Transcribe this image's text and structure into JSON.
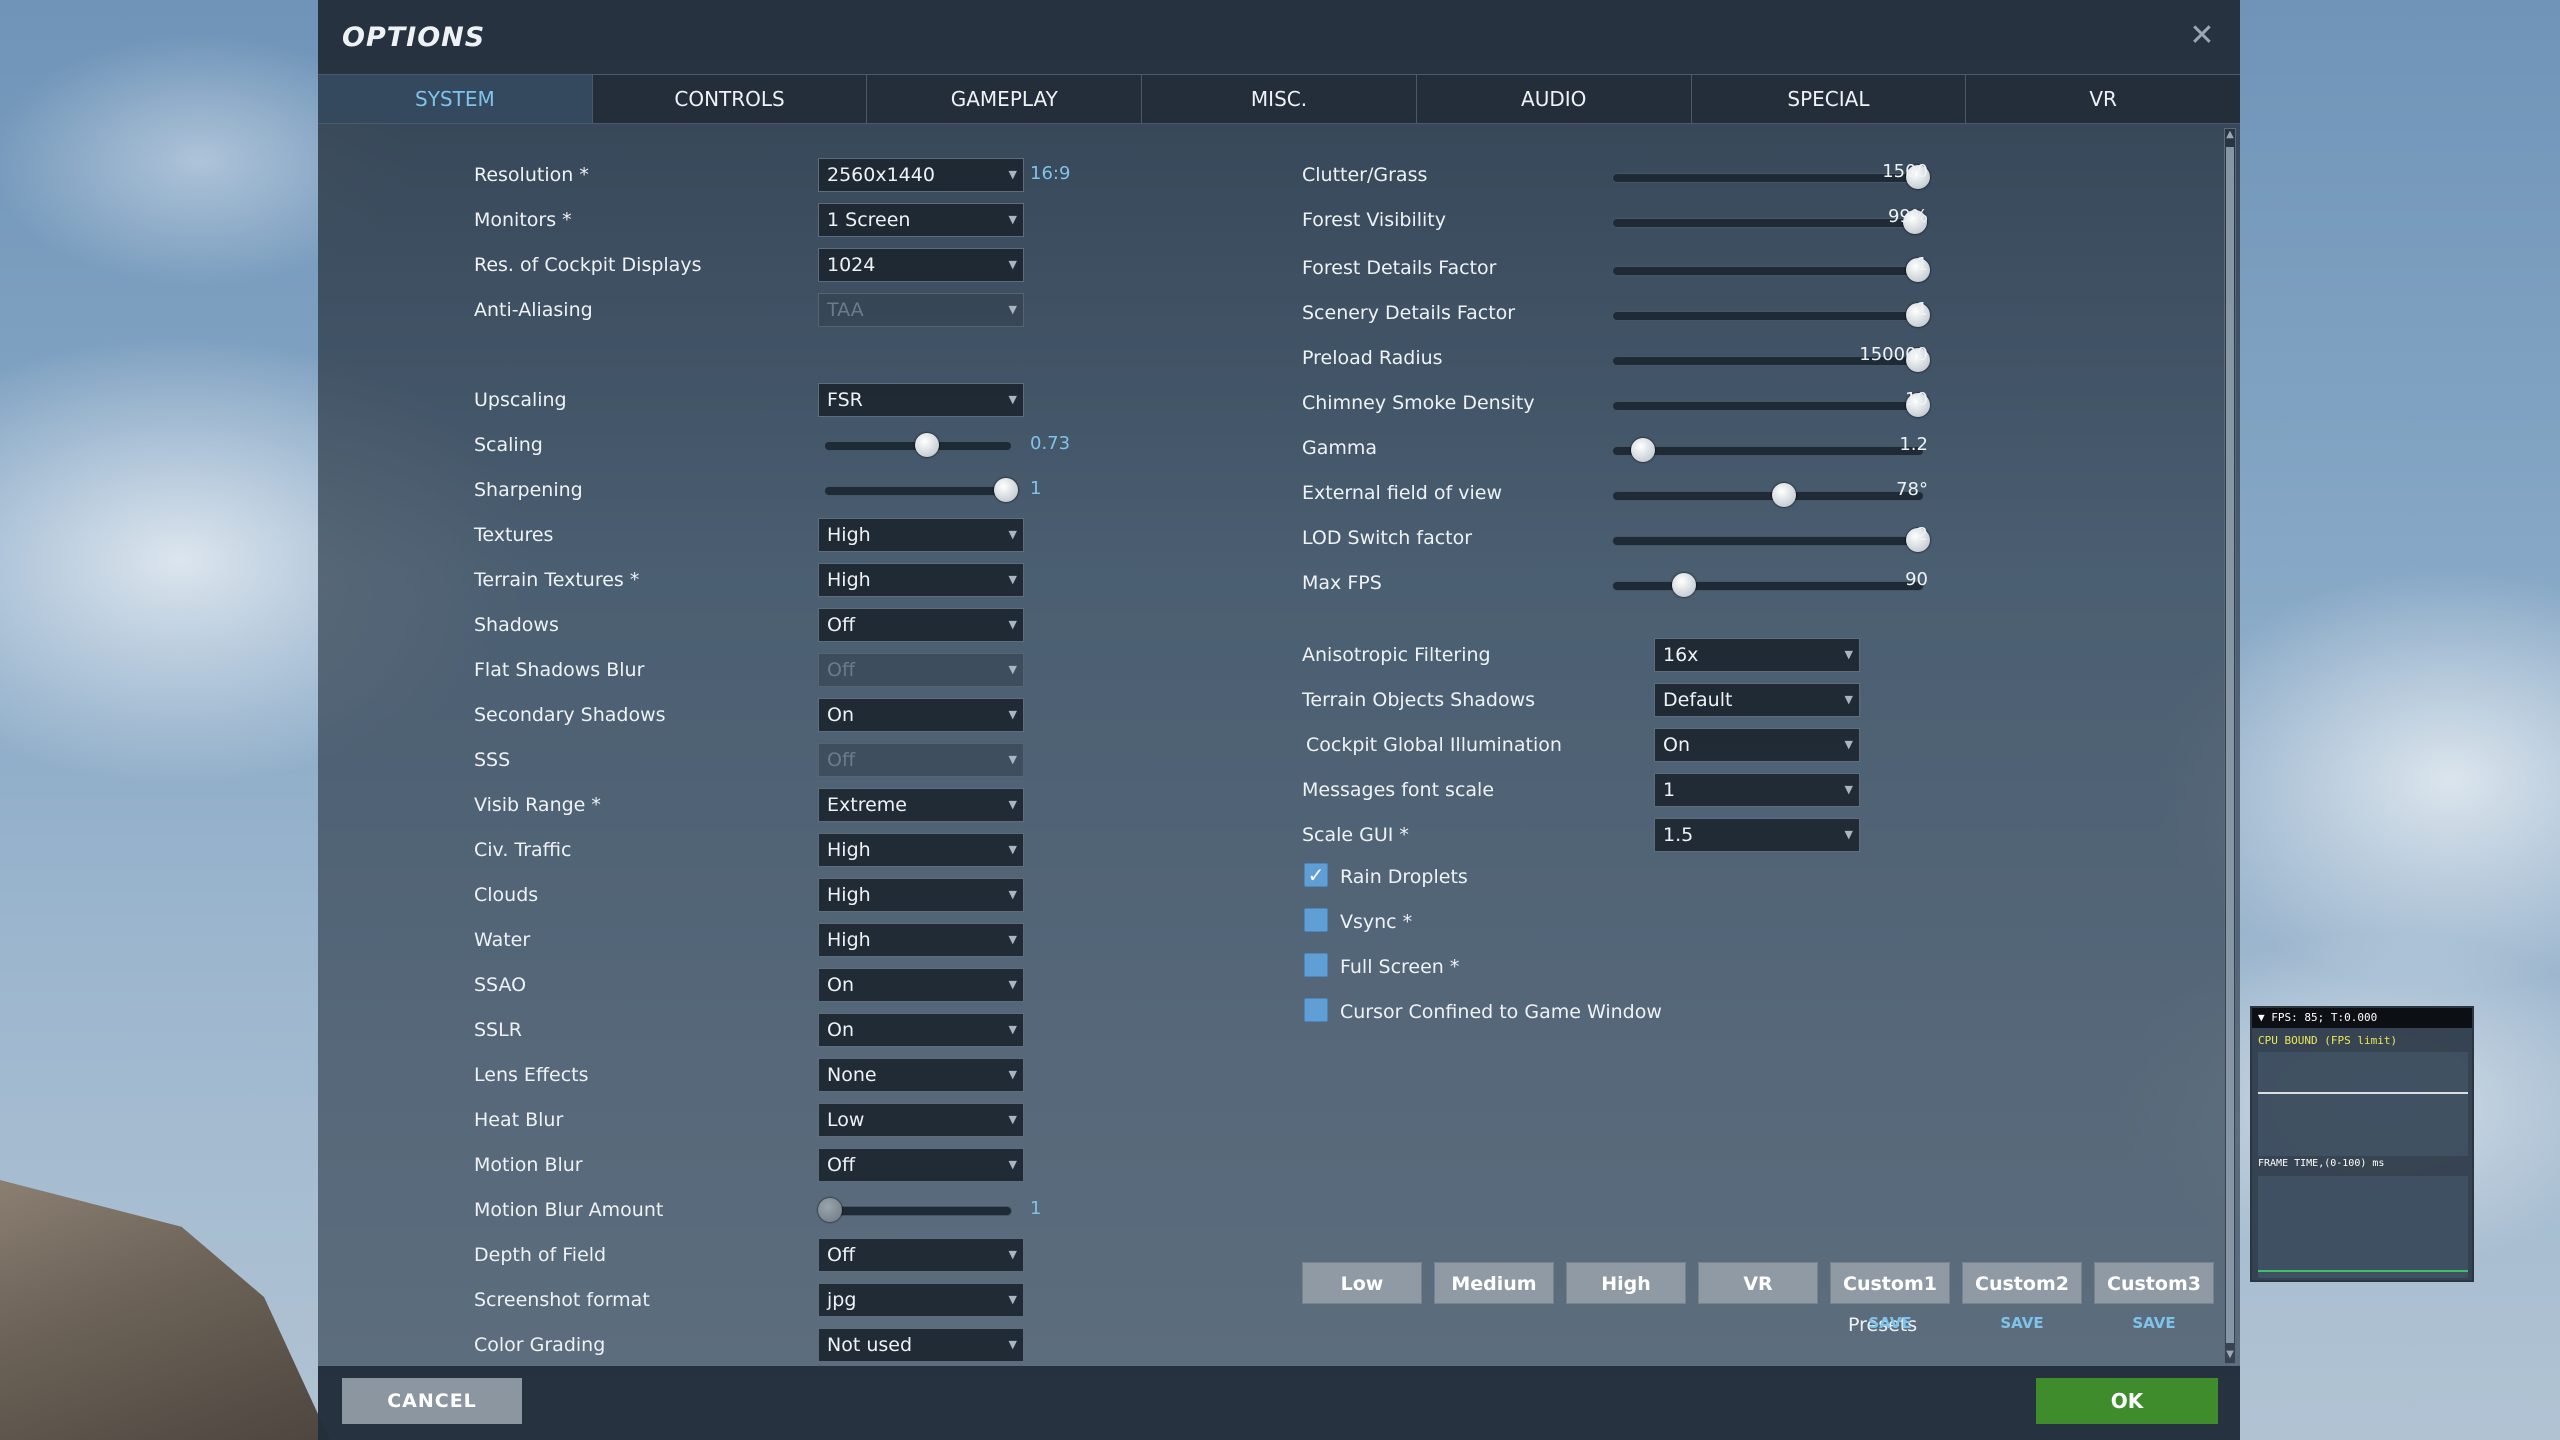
{
  "window": {
    "title": "OPTIONS"
  },
  "tabs": [
    "SYSTEM",
    "CONTROLS",
    "GAMEPLAY",
    "MISC.",
    "AUDIO",
    "SPECIAL",
    "VR"
  ],
  "left": {
    "resolution": {
      "label": "Resolution *",
      "value": "2560x1440",
      "aspect": "16:9"
    },
    "monitors": {
      "label": "Monitors *",
      "value": "1 Screen"
    },
    "cockpit_res": {
      "label": "Res. of Cockpit Displays",
      "value": "1024"
    },
    "aa": {
      "label": "Anti-Aliasing",
      "value": "TAA"
    },
    "upscaling": {
      "label": "Upscaling",
      "value": "FSR"
    },
    "scaling": {
      "label": "Scaling",
      "value": "0.73",
      "fraction": 0.55
    },
    "sharpening": {
      "label": "Sharpening",
      "value": "1",
      "fraction": 0.97
    },
    "textures": {
      "label": "Textures",
      "value": "High"
    },
    "terrain_textures": {
      "label": "Terrain Textures *",
      "value": "High"
    },
    "shadows": {
      "label": "Shadows",
      "value": "Off"
    },
    "flat_shadows_blur": {
      "label": "Flat Shadows Blur",
      "value": "Off"
    },
    "secondary_shadows": {
      "label": "Secondary Shadows",
      "value": "On"
    },
    "sss": {
      "label": "SSS",
      "value": "Off"
    },
    "visib_range": {
      "label": "Visib Range *",
      "value": "Extreme"
    },
    "civ_traffic": {
      "label": "Civ. Traffic",
      "value": "High"
    },
    "clouds": {
      "label": "Clouds",
      "value": "High"
    },
    "water": {
      "label": "Water",
      "value": "High"
    },
    "ssao": {
      "label": "SSAO",
      "value": "On"
    },
    "sslr": {
      "label": "SSLR",
      "value": "On"
    },
    "lens_effects": {
      "label": "Lens Effects",
      "value": "None"
    },
    "heat_blur": {
      "label": "Heat Blur",
      "value": "Low"
    },
    "motion_blur": {
      "label": "Motion Blur",
      "value": "Off"
    },
    "motion_blur_amount": {
      "label": "Motion Blur Amount",
      "value": "1",
      "fraction": 0.03
    },
    "dof": {
      "label": "Depth of Field",
      "value": "Off"
    },
    "screenshot_format": {
      "label": "Screenshot format",
      "value": "jpg"
    },
    "color_grading": {
      "label": "Color Grading",
      "value": "Not used"
    }
  },
  "right": {
    "clutter": {
      "label": "Clutter/Grass",
      "value": "1500",
      "fraction": 0.98
    },
    "forest_vis": {
      "label": "Forest Visibility",
      "value": "99%",
      "fraction": 0.97
    },
    "forest_details": {
      "label": "Forest Details Factor",
      "value": "1",
      "fraction": 0.98
    },
    "scenery_details": {
      "label": "Scenery Details Factor",
      "value": "1",
      "fraction": 0.98
    },
    "preload_radius": {
      "label": "Preload Radius",
      "value": "150000",
      "fraction": 0.98
    },
    "chimney": {
      "label": "Chimney Smoke Density",
      "value": "10",
      "fraction": 0.98
    },
    "gamma": {
      "label": "Gamma",
      "value": "1.2",
      "fraction": 0.1
    },
    "ext_fov": {
      "label": "External field of view",
      "value": "78°",
      "fraction": 0.55
    },
    "lod": {
      "label": "LOD Switch factor",
      "value": "2",
      "fraction": 0.98
    },
    "max_fps": {
      "label": "Max FPS",
      "value": "90",
      "fraction": 0.23
    },
    "aniso": {
      "label": "Anisotropic Filtering",
      "value": "16x"
    },
    "terrain_obj_shadows": {
      "label": "Terrain Objects Shadows",
      "value": "Default"
    },
    "cockpit_gi": {
      "label": "Cockpit Global Illumination",
      "value": "On"
    },
    "msg_font_scale": {
      "label": "Messages font scale",
      "value": "1"
    },
    "scale_gui": {
      "label": "Scale GUI *",
      "value": "1.5"
    },
    "rain_droplets": {
      "label": "Rain Droplets",
      "checked": true
    },
    "vsync": {
      "label": "Vsync *",
      "checked": false
    },
    "full_screen": {
      "label": "Full Screen *",
      "checked": false
    },
    "cursor_confined": {
      "label": "Cursor Confined to Game Window",
      "checked": false
    }
  },
  "presets": {
    "label": "Presets",
    "buttons": [
      "Low",
      "Medium",
      "High",
      "VR",
      "Custom1",
      "Custom2",
      "Custom3"
    ],
    "save_label": "SAVE"
  },
  "footer": {
    "cancel": "CANCEL",
    "ok": "OK"
  },
  "fps_overlay": {
    "header": "▼ FPS: 85; T:0.000",
    "cpu": "CPU BOUND (FPS limit)",
    "frame_time": "FRAME TIME,(0-100) ms"
  },
  "colors": {
    "accent": "#7fc3ea",
    "ok_green": "#3f8c2c",
    "checkbox": "#5f9fd6"
  }
}
